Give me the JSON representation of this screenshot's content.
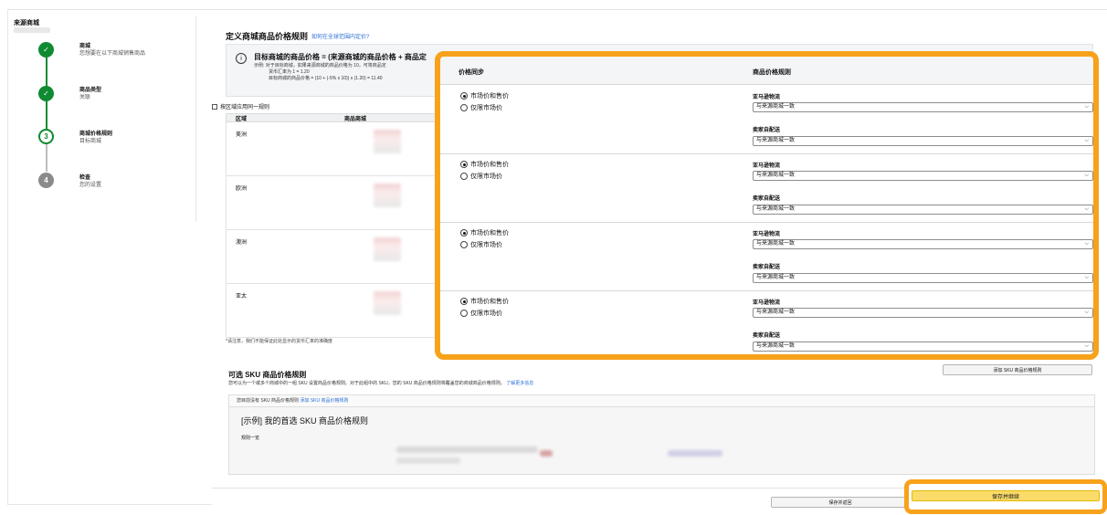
{
  "sidebar": {
    "title": "来源商城",
    "steps": [
      {
        "num": "✓",
        "title": "商城",
        "subtitle": "您想要在以下商城销售商品",
        "state": "done"
      },
      {
        "num": "✓",
        "title": "商品类型",
        "subtitle": "关联",
        "state": "done"
      },
      {
        "num": "3",
        "title": "商城价格规则",
        "subtitle": "目标商城",
        "state": "current"
      },
      {
        "num": "4",
        "title": "检查",
        "subtitle": "您的设置",
        "state": "todo"
      }
    ]
  },
  "main": {
    "title": "定义商城商品价格规则",
    "help_link": "如何在全球范围内定价?",
    "info": {
      "title": "目标商城的商品价格 = (来源商城的商品价格 + 商品定",
      "example_label": "示例:",
      "lines": [
        "对于目标商城，如果来源商城的商品价格为 10，可将商品定",
        "货币汇率为 1 = 1.20",
        "目标商城的商品价格 = (10 + (-5% x 10)) x (1.20) = 11.40"
      ]
    },
    "checkbox_label": "按区域应用同一规则",
    "bg_table": {
      "headers": [
        "区域",
        "商品商城"
      ],
      "regions": [
        "美洲",
        "欧洲",
        "澳洲",
        "亚太"
      ]
    },
    "note": "*请注意，我们不能保证此处显示的货币汇率的准确度"
  },
  "panel": {
    "col1": "价格同步",
    "col2": "商品价格规则",
    "rows": [
      {
        "radio1": "市场价和售价",
        "radio2": "仅限市场价",
        "label1": "亚马逊物流",
        "select1": "与来源商城一致",
        "label2": "卖家自配送",
        "select2": "与来源商城一致"
      },
      {
        "radio1": "市场价和售价",
        "radio2": "仅限市场价",
        "label1": "亚马逊物流",
        "select1": "与来源商城一致",
        "label2": "卖家自配送",
        "select2": "与来源商城一致"
      },
      {
        "radio1": "市场价和售价",
        "radio2": "仅限市场价",
        "label1": "亚马逊物流",
        "select1": "与来源商城一致",
        "label2": "卖家自配送",
        "select2": "与来源商城一致"
      },
      {
        "radio1": "市场价和售价",
        "radio2": "仅限市场价",
        "label1": "亚马逊物流",
        "select1": "与来源商城一致",
        "label2": "卖家自配送",
        "select2": "与来源商城一致"
      }
    ]
  },
  "optional": {
    "title": "可选 SKU 商品价格规则",
    "desc": "您可以为一个或多个商城中的一组 SKU 设置商品价格规则。对于此组中的 SKU，您的 SKU 商品价格规则将覆盖您的商城商品价格规则。",
    "learn_more": "了解更多信息",
    "add_button": "添加 SKU 商品价格规则",
    "bar_text": "您目前没有 SKU 商品价格规则",
    "bar_link": "添加 SKU 商品价格规则",
    "example_name": "[示例] 我的首选 SKU 商品价格规则",
    "rule_label": "规则一览"
  },
  "footer": {
    "back": "保存并返回",
    "next": "保存并继续"
  },
  "colors": {
    "accent": "#f7a21b",
    "success": "#0f8a31",
    "primary_btn": "#fbdc6a"
  }
}
